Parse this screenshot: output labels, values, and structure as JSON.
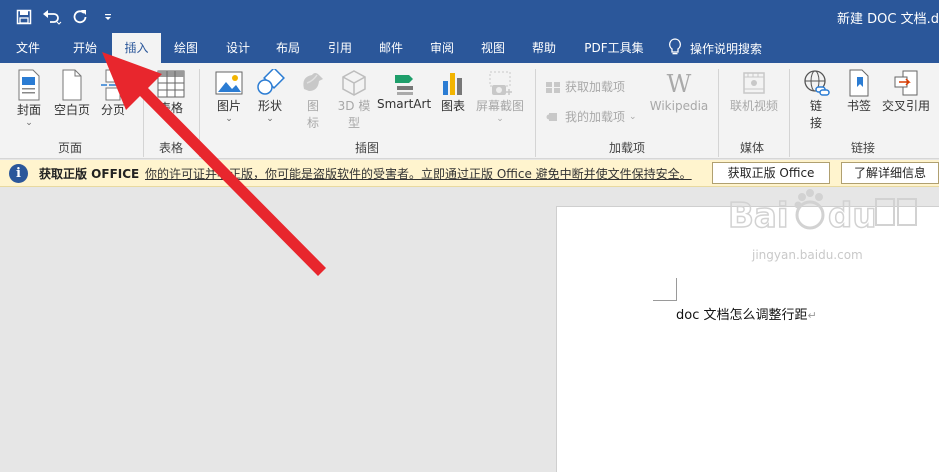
{
  "window": {
    "title": "新建 DOC 文档.d"
  },
  "quick_access": [
    {
      "icon": "save-icon"
    },
    {
      "icon": "undo-icon"
    },
    {
      "icon": "redo-icon"
    },
    {
      "icon": "customize-icon"
    }
  ],
  "tabs": [
    {
      "label": "文件"
    },
    {
      "label": "开始"
    },
    {
      "label": "插入"
    },
    {
      "label": "绘图"
    },
    {
      "label": "设计"
    },
    {
      "label": "布局"
    },
    {
      "label": "引用"
    },
    {
      "label": "邮件"
    },
    {
      "label": "审阅"
    },
    {
      "label": "视图"
    },
    {
      "label": "帮助"
    },
    {
      "label": "PDF工具集"
    }
  ],
  "tellme": {
    "label": "操作说明搜索",
    "icon": "lightbulb-icon"
  },
  "ribbon": {
    "pages": {
      "cover": "封面",
      "blank": "空白页",
      "break": "分页",
      "group": "页面"
    },
    "table": {
      "label": "表格",
      "group": "表格"
    },
    "illustrations": {
      "picture": "图片",
      "shapes": "形状",
      "icons_1": "图",
      "icons_2": "标",
      "model_1": "3D 模",
      "model_2": "型",
      "smartart": "SmartArt",
      "chart": "图表",
      "screenshot": "屏幕截图",
      "group": "插图"
    },
    "addins": {
      "get": "获取加载项",
      "mine": "我的加载项",
      "wikipedia": "Wikipedia",
      "group": "加载项"
    },
    "media": {
      "video": "联机视频",
      "group": "媒体"
    },
    "links": {
      "link_1": "链",
      "link_2": "接",
      "bookmark": "书签",
      "crossref": "交叉引用",
      "group": "链接"
    }
  },
  "message_bar": {
    "title": "获取正版 OFFICE",
    "text": "你的许可证并非正版，你可能是盗版软件的受害者。立即通过正版 Office 避免中断并使文件保持安全。",
    "btn_genuine": "获取正版 Office",
    "btn_learn": "了解详细信息"
  },
  "document": {
    "text": "doc 文档怎么调整行距",
    "para_mark": "↵"
  },
  "watermark": {
    "url": "jingyan.baidu.com"
  },
  "colors": {
    "accent": "#2b579a",
    "arrow": "#e8262d",
    "message": "#fff4ce"
  }
}
